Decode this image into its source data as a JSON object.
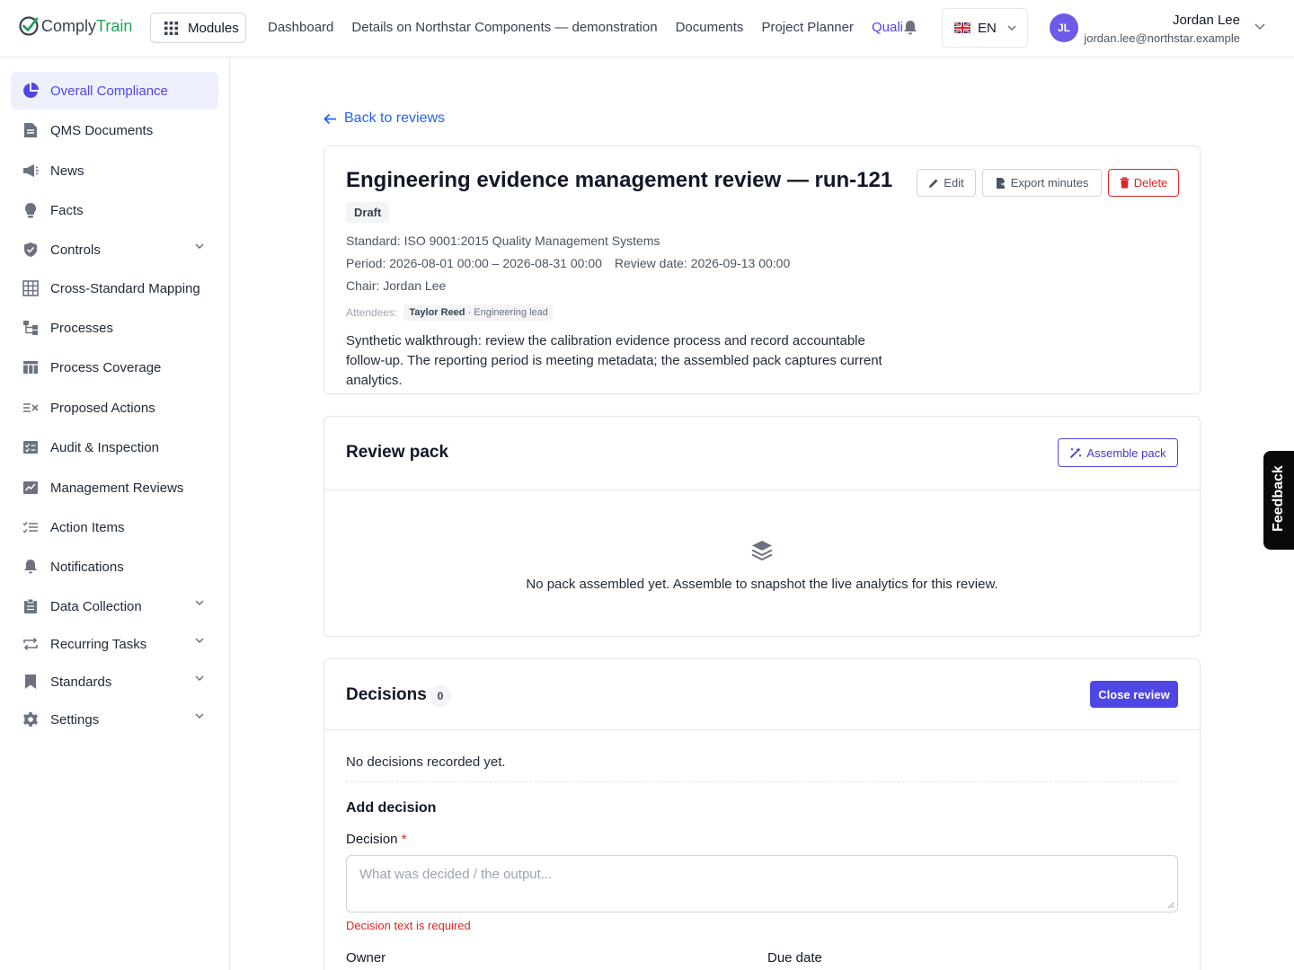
{
  "brand": {
    "part1": "Comply",
    "part2": "Train",
    "accent": "#22a35a"
  },
  "topnav": {
    "modules_label": "Modules",
    "links": [
      "Dashboard",
      "Details on Northstar Components — demonstration",
      "Documents",
      "Project Planner",
      "Quali"
    ],
    "language": "EN"
  },
  "user": {
    "initials": "JL",
    "name": "Jordan Lee",
    "email": "jordan.lee@northstar.example"
  },
  "sidebar": {
    "items": [
      {
        "label": "Overall Compliance",
        "icon": "pie-chart-icon",
        "active": true
      },
      {
        "label": "QMS Documents",
        "icon": "document-icon"
      },
      {
        "label": "News",
        "icon": "megaphone-icon"
      },
      {
        "label": "Facts",
        "icon": "lightbulb-icon"
      },
      {
        "label": "Controls",
        "icon": "shield-icon",
        "expandable": true
      },
      {
        "label": "Cross-Standard Mapping",
        "icon": "grid-icon"
      },
      {
        "label": "Processes",
        "icon": "flow-icon"
      },
      {
        "label": "Process Coverage",
        "icon": "table-icon"
      },
      {
        "label": "Proposed Actions",
        "icon": "list-x-icon"
      },
      {
        "label": "Audit & Inspection",
        "icon": "checklist-icon"
      },
      {
        "label": "Management Reviews",
        "icon": "chart-edit-icon"
      },
      {
        "label": "Action Items",
        "icon": "checklist-lines-icon"
      },
      {
        "label": "Notifications",
        "icon": "bell-icon"
      },
      {
        "label": "Data Collection",
        "icon": "clipboard-icon",
        "expandable": true
      },
      {
        "label": "Recurring Tasks",
        "icon": "repeat-icon",
        "expandable": true
      },
      {
        "label": "Standards",
        "icon": "bookmark-icon",
        "expandable": true
      },
      {
        "label": "Settings",
        "icon": "gear-icon",
        "expandable": true
      }
    ]
  },
  "back_label": "Back to reviews",
  "review": {
    "title": "Engineering evidence management review — run-121",
    "status": "Draft",
    "standard": "Standard: ISO 9001:2015 Quality Management Systems",
    "period": "Period: 2026-08-01 00:00 – 2026-08-31 00:00",
    "review_date": "Review date: 2026-09-13 00:00",
    "chair": "Chair: Jordan Lee",
    "attendees_label": "Attendees:",
    "attendee_name": "Taylor Reed",
    "attendee_role": " · Engineering lead",
    "description": "Synthetic walkthrough: review the calibration evidence process and record accountable follow-up. The reporting period is meeting metadata; the assembled pack captures current analytics.",
    "actions": {
      "edit": "Edit",
      "export": "Export minutes",
      "delete": "Delete"
    }
  },
  "review_pack": {
    "title": "Review pack",
    "assemble_label": "Assemble pack",
    "empty_text": "No pack assembled yet. Assemble to snapshot the live analytics for this review."
  },
  "decisions": {
    "title": "Decisions",
    "count": "0",
    "close_label": "Close review",
    "empty_text": "No decisions recorded yet.",
    "add_title": "Add decision",
    "decision_label": "Decision",
    "required_mark": "*",
    "decision_placeholder": "What was decided / the output...",
    "error": "Decision text is required",
    "owner_label": "Owner",
    "due_label": "Due date"
  },
  "feedback_label": "Feedback"
}
